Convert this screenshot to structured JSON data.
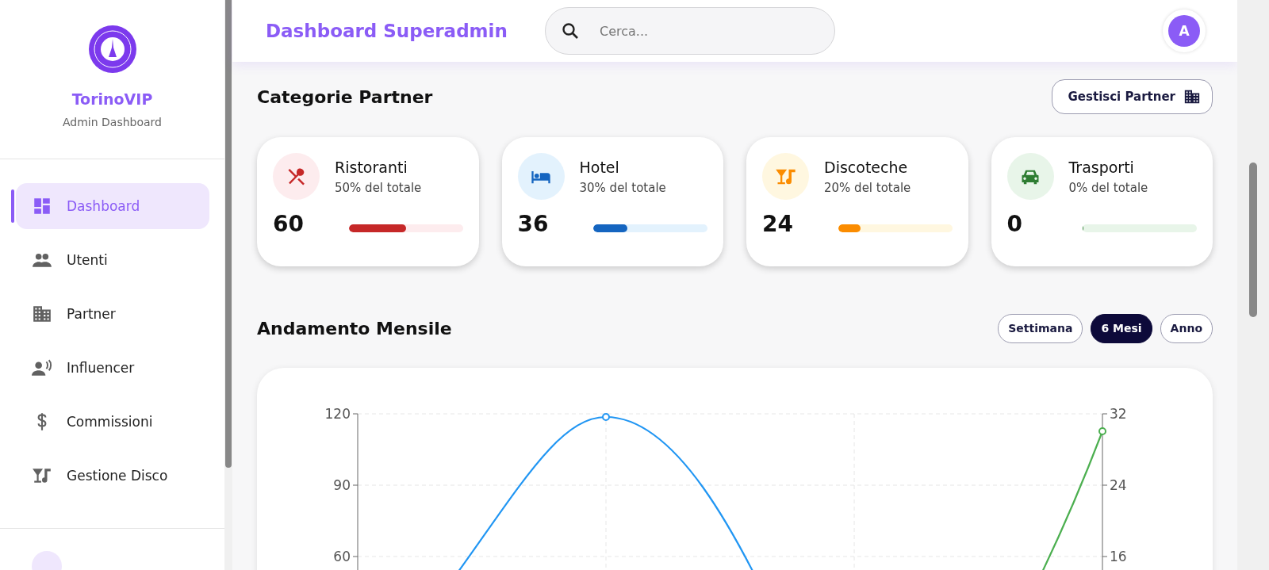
{
  "sidebar": {
    "brand": "TorinoVIP",
    "subtitle": "Admin Dashboard",
    "items": [
      {
        "label": "Dashboard",
        "selected": true
      },
      {
        "label": "Utenti",
        "selected": false
      },
      {
        "label": "Partner",
        "selected": false
      },
      {
        "label": "Influencer",
        "selected": false
      },
      {
        "label": "Commissioni",
        "selected": false
      },
      {
        "label": "Gestione Disco",
        "selected": false
      }
    ]
  },
  "header": {
    "title": "Dashboard Superadmin",
    "search": {
      "placeholder": "Cerca..."
    },
    "avatar": "A"
  },
  "categories": {
    "title": "Categorie Partner",
    "button": "Gestisci Partner",
    "cards": [
      {
        "name": "Ristoranti",
        "share": "50% del totale",
        "count": "60",
        "level": 0.5,
        "color": "#c62828"
      },
      {
        "name": "Hotel",
        "share": "30% del totale",
        "count": "36",
        "level": 0.3,
        "color": "#1565c0"
      },
      {
        "name": "Discoteche",
        "share": "20% del totale",
        "count": "24",
        "level": 0.2,
        "color": "#fb8c00"
      },
      {
        "name": "Trasporti",
        "share": "0% del totale",
        "count": "0",
        "level": 0,
        "color": "#2e7d32"
      }
    ]
  },
  "trend": {
    "title": "Andamento Mensile",
    "periods": [
      {
        "label": "Settimana",
        "selected": false
      },
      {
        "label": "6 Mesi",
        "selected": true
      },
      {
        "label": "Anno",
        "selected": false
      }
    ],
    "chart": {
      "left_ticks": [
        "120",
        "90",
        "60"
      ],
      "right_ticks": [
        "32",
        "24",
        "16"
      ]
    }
  }
}
